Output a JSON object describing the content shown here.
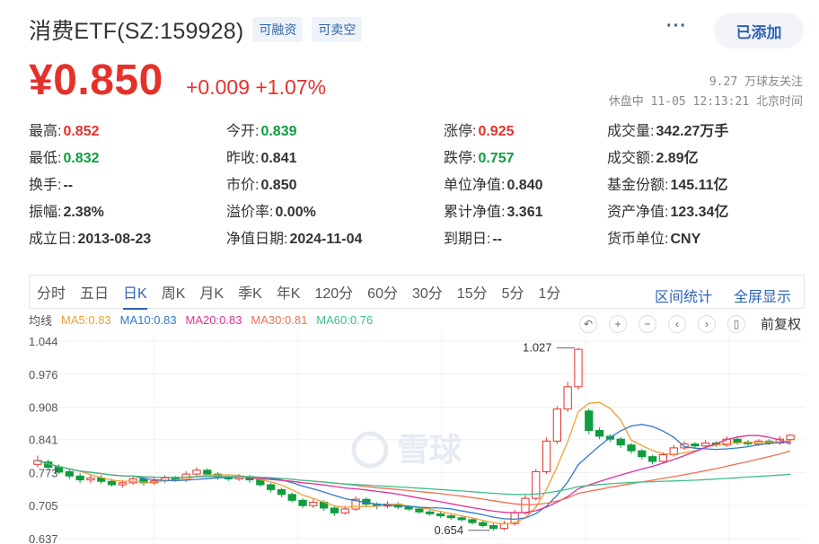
{
  "header": {
    "title": "消费ETF(SZ:159928)",
    "tags": [
      "可融资",
      "可卖空"
    ],
    "more": "···",
    "added_label": "已添加"
  },
  "quote": {
    "price": "¥0.850",
    "change": "+0.009 +1.07%",
    "followers": "9.27 万球友关注",
    "status": "休盘中 11-05 12:13:21 北京时间"
  },
  "stats": {
    "col1": [
      {
        "k": "最高:",
        "v": "0.852",
        "c": "red"
      },
      {
        "k": "最低:",
        "v": "0.832",
        "c": "green"
      },
      {
        "k": "换手:",
        "v": "--",
        "c": ""
      },
      {
        "k": "振幅:",
        "v": "2.38%",
        "c": ""
      },
      {
        "k": "成立日:",
        "v": "2013-08-23",
        "c": ""
      }
    ],
    "col2": [
      {
        "k": "今开:",
        "v": "0.839",
        "c": "green"
      },
      {
        "k": "昨收:",
        "v": "0.841",
        "c": ""
      },
      {
        "k": "市价:",
        "v": "0.850",
        "c": ""
      },
      {
        "k": "溢价率:",
        "v": "0.00%",
        "c": ""
      },
      {
        "k": "净值日期:",
        "v": "2024-11-04",
        "c": ""
      }
    ],
    "col3": [
      {
        "k": "涨停:",
        "v": "0.925",
        "c": "red"
      },
      {
        "k": "跌停:",
        "v": "0.757",
        "c": "green"
      },
      {
        "k": "单位净值:",
        "v": "0.840",
        "c": ""
      },
      {
        "k": "累计净值:",
        "v": "3.361",
        "c": ""
      },
      {
        "k": "到期日:",
        "v": "--",
        "c": ""
      }
    ],
    "col4": [
      {
        "k": "成交量:",
        "v": "342.27万手",
        "c": ""
      },
      {
        "k": "成交额:",
        "v": "2.89亿",
        "c": ""
      },
      {
        "k": "基金份额:",
        "v": "145.11亿",
        "c": ""
      },
      {
        "k": "资产净值:",
        "v": "123.34亿",
        "c": ""
      },
      {
        "k": "货币单位:",
        "v": "CNY",
        "c": ""
      }
    ]
  },
  "tabs": [
    "分时",
    "五日",
    "日K",
    "周K",
    "月K",
    "季K",
    "年K",
    "120分",
    "60分",
    "30分",
    "15分",
    "5分",
    "1分"
  ],
  "active_tab": "日K",
  "tab_right": [
    "区间统计",
    "全屏显示"
  ],
  "ma": {
    "label": "均线",
    "items": [
      {
        "text": "MA5:0.83",
        "color": "#f0a030"
      },
      {
        "text": "MA10:0.83",
        "color": "#2f7ad0"
      },
      {
        "text": "MA20:0.83",
        "color": "#e0309a"
      },
      {
        "text": "MA30:0.81",
        "color": "#f07050"
      },
      {
        "text": "MA60:0.76",
        "color": "#3cc08a"
      }
    ]
  },
  "controls": {
    "icons": [
      "undo-icon",
      "zoom-in-icon",
      "zoom-out-icon",
      "prev-icon",
      "next-icon",
      "adjust-icon"
    ],
    "glyphs": [
      "↶",
      "+",
      "−",
      "‹",
      "›",
      "▯"
    ],
    "fq_label": "前复权"
  },
  "chart_data": {
    "type": "candlestick",
    "y_ticks": [
      "1.044",
      "0.976",
      "0.908",
      "0.841",
      "0.773",
      "0.705",
      "0.637"
    ],
    "ylim": [
      0.637,
      1.044
    ],
    "high_label": "1.027",
    "low_label": "0.654",
    "watermark": "雪球",
    "colors": {
      "up": "#e4322b",
      "down": "#0f9d3f"
    },
    "candles": [
      [
        0.79,
        0.798,
        0.808,
        0.784
      ],
      [
        0.795,
        0.784,
        0.8,
        0.778
      ],
      [
        0.785,
        0.774,
        0.79,
        0.77
      ],
      [
        0.775,
        0.766,
        0.78,
        0.76
      ],
      [
        0.766,
        0.758,
        0.772,
        0.752
      ],
      [
        0.758,
        0.762,
        0.768,
        0.752
      ],
      [
        0.762,
        0.755,
        0.768,
        0.75
      ],
      [
        0.755,
        0.748,
        0.76,
        0.744
      ],
      [
        0.748,
        0.752,
        0.758,
        0.742
      ],
      [
        0.752,
        0.76,
        0.766,
        0.748
      ],
      [
        0.76,
        0.752,
        0.764,
        0.746
      ],
      [
        0.752,
        0.756,
        0.762,
        0.748
      ],
      [
        0.756,
        0.762,
        0.768,
        0.752
      ],
      [
        0.762,
        0.758,
        0.766,
        0.754
      ],
      [
        0.758,
        0.77,
        0.776,
        0.754
      ],
      [
        0.77,
        0.778,
        0.784,
        0.766
      ],
      [
        0.778,
        0.77,
        0.782,
        0.764
      ],
      [
        0.77,
        0.764,
        0.774,
        0.758
      ],
      [
        0.764,
        0.76,
        0.768,
        0.756
      ],
      [
        0.76,
        0.765,
        0.77,
        0.756
      ],
      [
        0.765,
        0.758,
        0.768,
        0.752
      ],
      [
        0.758,
        0.748,
        0.762,
        0.744
      ],
      [
        0.748,
        0.738,
        0.752,
        0.732
      ],
      [
        0.738,
        0.728,
        0.742,
        0.722
      ],
      [
        0.728,
        0.716,
        0.732,
        0.712
      ],
      [
        0.716,
        0.705,
        0.72,
        0.7
      ],
      [
        0.705,
        0.712,
        0.718,
        0.7
      ],
      [
        0.712,
        0.7,
        0.716,
        0.694
      ],
      [
        0.7,
        0.69,
        0.704,
        0.684
      ],
      [
        0.69,
        0.698,
        0.704,
        0.686
      ],
      [
        0.698,
        0.718,
        0.724,
        0.694
      ],
      [
        0.718,
        0.708,
        0.722,
        0.702
      ],
      [
        0.708,
        0.704,
        0.712,
        0.698
      ],
      [
        0.704,
        0.708,
        0.714,
        0.7
      ],
      [
        0.708,
        0.702,
        0.712,
        0.698
      ],
      [
        0.702,
        0.698,
        0.706,
        0.694
      ],
      [
        0.698,
        0.692,
        0.702,
        0.688
      ],
      [
        0.692,
        0.688,
        0.696,
        0.684
      ],
      [
        0.688,
        0.684,
        0.692,
        0.68
      ],
      [
        0.684,
        0.68,
        0.688,
        0.676
      ],
      [
        0.68,
        0.676,
        0.684,
        0.672
      ],
      [
        0.676,
        0.67,
        0.68,
        0.666
      ],
      [
        0.67,
        0.664,
        0.674,
        0.66
      ],
      [
        0.664,
        0.658,
        0.668,
        0.654
      ],
      [
        0.658,
        0.668,
        0.674,
        0.654
      ],
      [
        0.668,
        0.69,
        0.696,
        0.664
      ],
      [
        0.69,
        0.72,
        0.726,
        0.686
      ],
      [
        0.72,
        0.775,
        0.78,
        0.716
      ],
      [
        0.775,
        0.838,
        0.845,
        0.77
      ],
      [
        0.838,
        0.904,
        0.91,
        0.832
      ],
      [
        0.904,
        0.95,
        0.96,
        0.898
      ],
      [
        0.95,
        1.027,
        1.03,
        0.944
      ],
      [
        0.9,
        0.86,
        0.905,
        0.852
      ],
      [
        0.86,
        0.848,
        0.866,
        0.842
      ],
      [
        0.848,
        0.842,
        0.852,
        0.836
      ],
      [
        0.842,
        0.83,
        0.846,
        0.824
      ],
      [
        0.83,
        0.818,
        0.834,
        0.812
      ],
      [
        0.818,
        0.806,
        0.822,
        0.8
      ],
      [
        0.806,
        0.796,
        0.81,
        0.79
      ],
      [
        0.796,
        0.81,
        0.815,
        0.792
      ],
      [
        0.81,
        0.824,
        0.83,
        0.806
      ],
      [
        0.824,
        0.832,
        0.838,
        0.82
      ],
      [
        0.832,
        0.828,
        0.836,
        0.822
      ],
      [
        0.828,
        0.834,
        0.84,
        0.824
      ],
      [
        0.834,
        0.83,
        0.838,
        0.826
      ],
      [
        0.83,
        0.842,
        0.848,
        0.826
      ],
      [
        0.842,
        0.836,
        0.846,
        0.83
      ],
      [
        0.836,
        0.832,
        0.84,
        0.828
      ],
      [
        0.832,
        0.838,
        0.842,
        0.828
      ],
      [
        0.838,
        0.834,
        0.842,
        0.83
      ],
      [
        0.834,
        0.842,
        0.848,
        0.83
      ],
      [
        0.841,
        0.85,
        0.852,
        0.832
      ]
    ]
  }
}
